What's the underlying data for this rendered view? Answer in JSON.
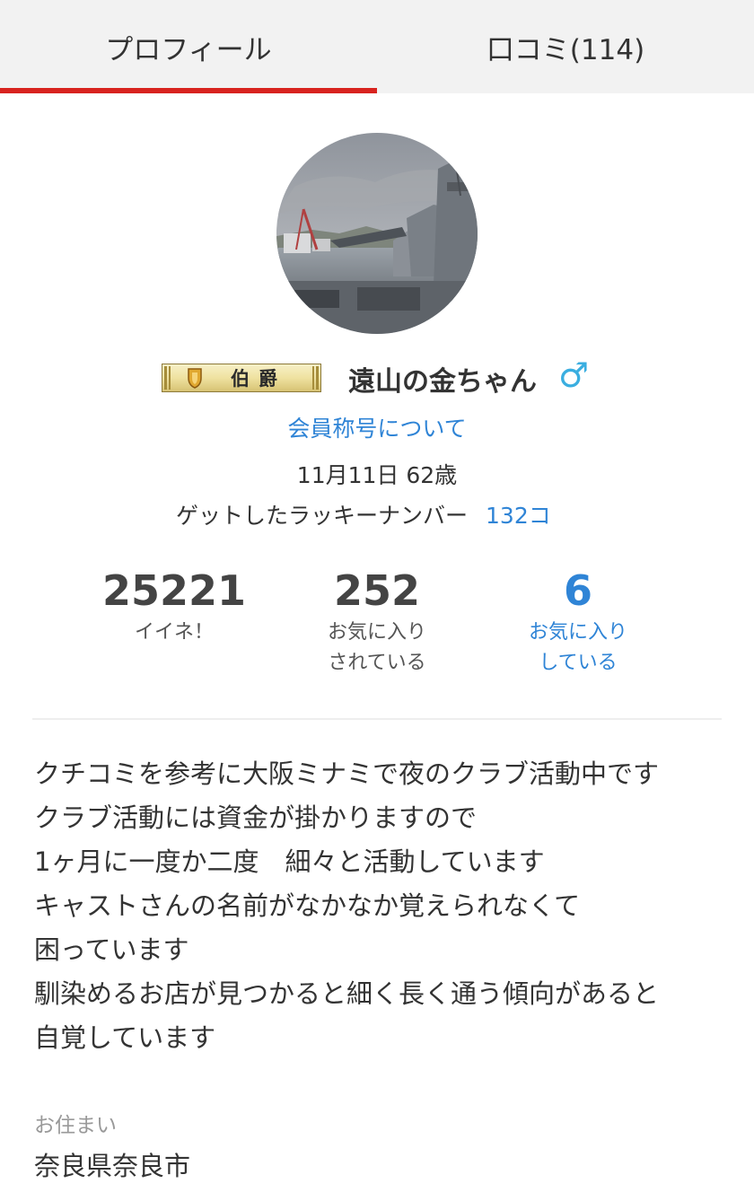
{
  "tabs": [
    {
      "label": "プロフィール",
      "active": true
    },
    {
      "label": "口コミ(114)",
      "active": false
    }
  ],
  "colors": {
    "tab_active_underline": "#d8231f",
    "link": "#2f84d6",
    "gender": "#3aaee0",
    "tab_bar_bg": "#f2f2f2"
  },
  "profile": {
    "rank_badge": "伯爵",
    "username": "遠山の金ちゃん",
    "gender_symbol": "♂",
    "title_link": "会員称号について",
    "birthday_age": "11月11日 62歳",
    "lucky_label": "ゲットしたラッキーナンバー",
    "lucky_value": "132コ"
  },
  "stats": [
    {
      "value": "25221",
      "line1": "イイネ！",
      "line2": ""
    },
    {
      "value": "252",
      "line1": "お気に入り",
      "line2": "されている"
    },
    {
      "value": "6",
      "line1": "お気に入り",
      "line2": "している"
    }
  ],
  "intro_lines": [
    "クチコミを参考に大阪ミナミで夜のクラブ活動中です",
    "クラブ活動には資金が掛かりますので",
    "1ヶ月に一度か二度　細々と活動しています",
    "キャストさんの名前がなかなか覚えられなくて",
    "困っています",
    "馴染めるお店が見つかると細く長く通う傾向があると",
    "自覚しています"
  ],
  "residence": {
    "label": "お住まい",
    "value": "奈良県奈良市"
  }
}
